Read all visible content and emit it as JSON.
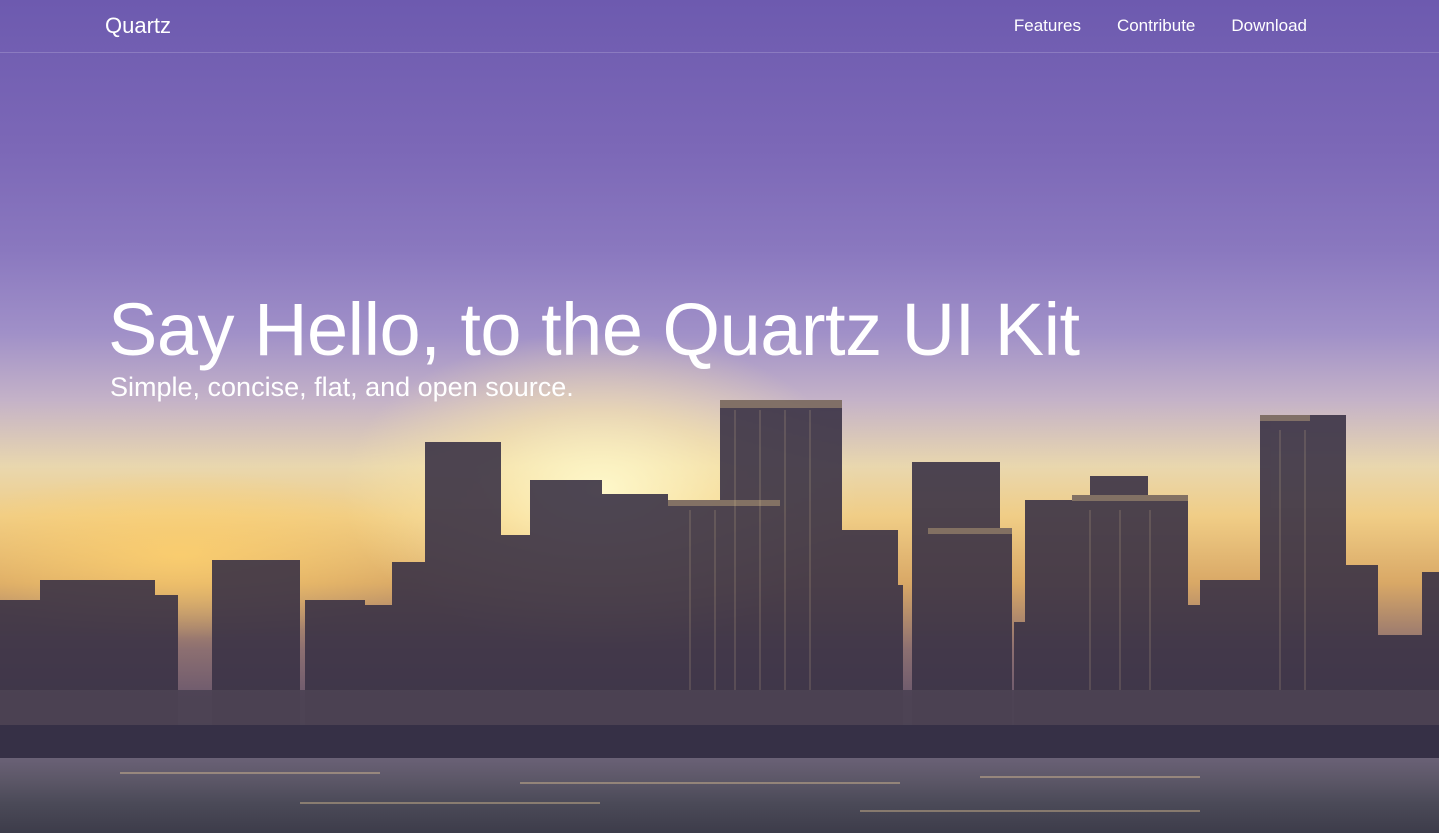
{
  "navbar": {
    "brand": "Quartz",
    "links": [
      {
        "label": "Features"
      },
      {
        "label": "Contribute"
      },
      {
        "label": "Download"
      }
    ]
  },
  "hero": {
    "headline": "Say Hello, to the Quartz UI Kit",
    "subheadline": "Simple, concise, flat, and open source.",
    "background": "city-skyline-waterfront-image"
  },
  "colors": {
    "text": "#ffffff",
    "sky_top": "#6d5aaf",
    "sunset": "#f0cd86"
  }
}
